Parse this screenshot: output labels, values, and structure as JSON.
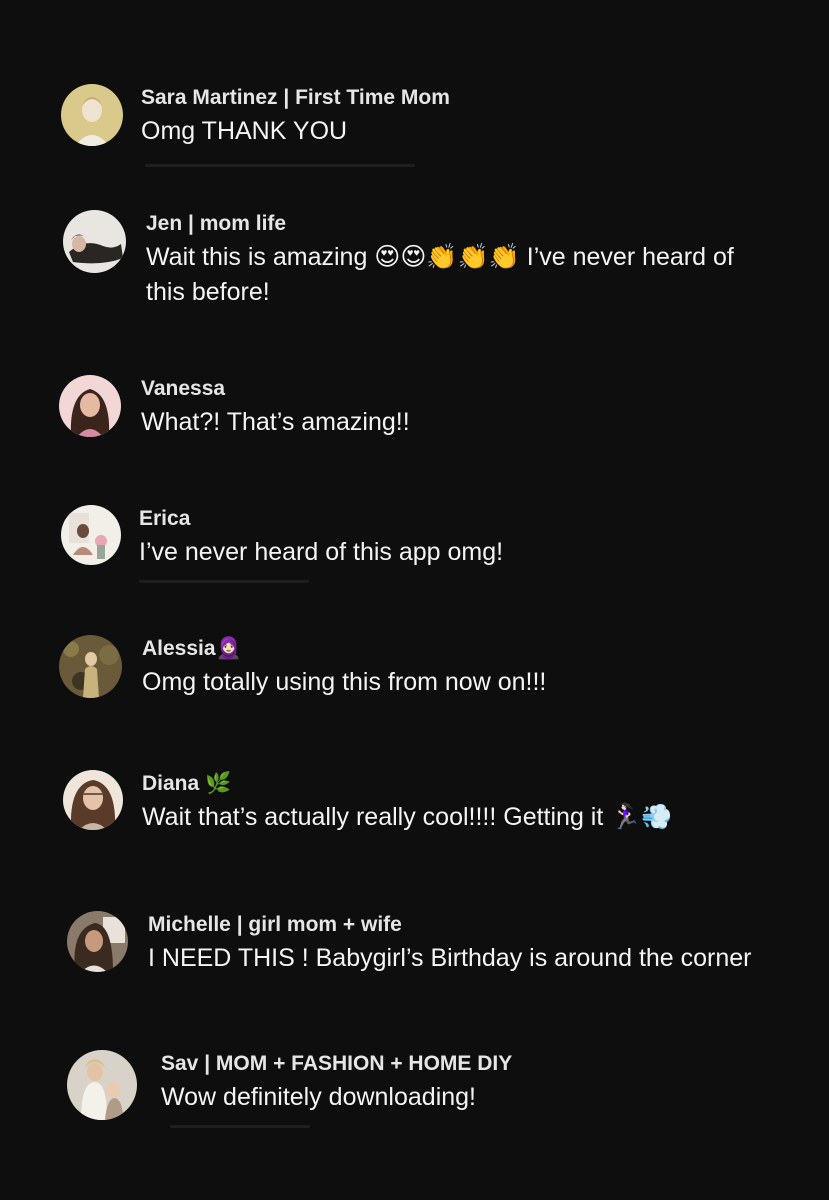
{
  "comments": [
    {
      "username": "Sara Martinez | First Time Mom",
      "text": "Omg THANK YOU",
      "avatar_colors": [
        "#d9c98a",
        "#f1ece2",
        "#c9b8a7"
      ]
    },
    {
      "username": "Jen | mom life",
      "text": "Wait this is amazing 😍😍👏👏👏 I’ve never heard of this before!",
      "avatar_colors": [
        "#e9e6e2",
        "#2a2624",
        "#c9c2bb"
      ]
    },
    {
      "username": "Vanessa",
      "text": "What?! That’s amazing!!",
      "avatar_colors": [
        "#f2d7d6",
        "#3a241c",
        "#d48aa1"
      ]
    },
    {
      "username": "Erica",
      "text": "I’ve never heard of this app omg!",
      "avatar_colors": [
        "#e8e1da",
        "#b98a78",
        "#f2efe9"
      ]
    },
    {
      "username": "Alessia🧕🏻",
      "text": "Omg totally using this from now on!!!",
      "avatar_colors": [
        "#6a5a3a",
        "#c9b37c",
        "#3d3524"
      ]
    },
    {
      "username": "Diana 🌿",
      "text": "Wait that’s actually really cool!!!! Getting it 🏃🏻‍♀️💨",
      "avatar_colors": [
        "#c9b7a6",
        "#5a3b2a",
        "#efe5da"
      ]
    },
    {
      "username": "Michelle | girl mom + wife",
      "text": "I NEED THIS ! Babygirl’s Birthday is around the corner",
      "avatar_colors": [
        "#8a7a6a",
        "#3a2a20",
        "#e8e2da"
      ]
    },
    {
      "username": "Sav | MOM + FASHION + HOME DIY",
      "text": "Wow definitely downloading!",
      "avatar_colors": [
        "#d8d2c8",
        "#f4f0ea",
        "#b09a88"
      ]
    }
  ]
}
